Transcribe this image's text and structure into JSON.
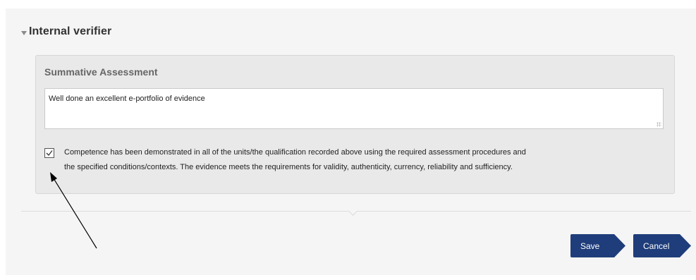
{
  "section": {
    "title": "Internal verifier"
  },
  "card": {
    "title": "Summative Assessment",
    "comment_value": "Well done an excellent e-portfolio of evidence",
    "checkbox_checked": true,
    "checkbox_label_line1": "Competence has been demonstrated in all of the units/the qualification recorded above using the required assessment procedures and",
    "checkbox_label_line2": "the specified conditions/contexts. The evidence meets the requirements for validity, authenticity, currency, reliability and sufficiency."
  },
  "actions": {
    "save_label": "Save",
    "cancel_label": "Cancel"
  },
  "colors": {
    "button": "#1f3d7a",
    "panel": "#f5f5f5",
    "card": "#e9e9e9"
  }
}
